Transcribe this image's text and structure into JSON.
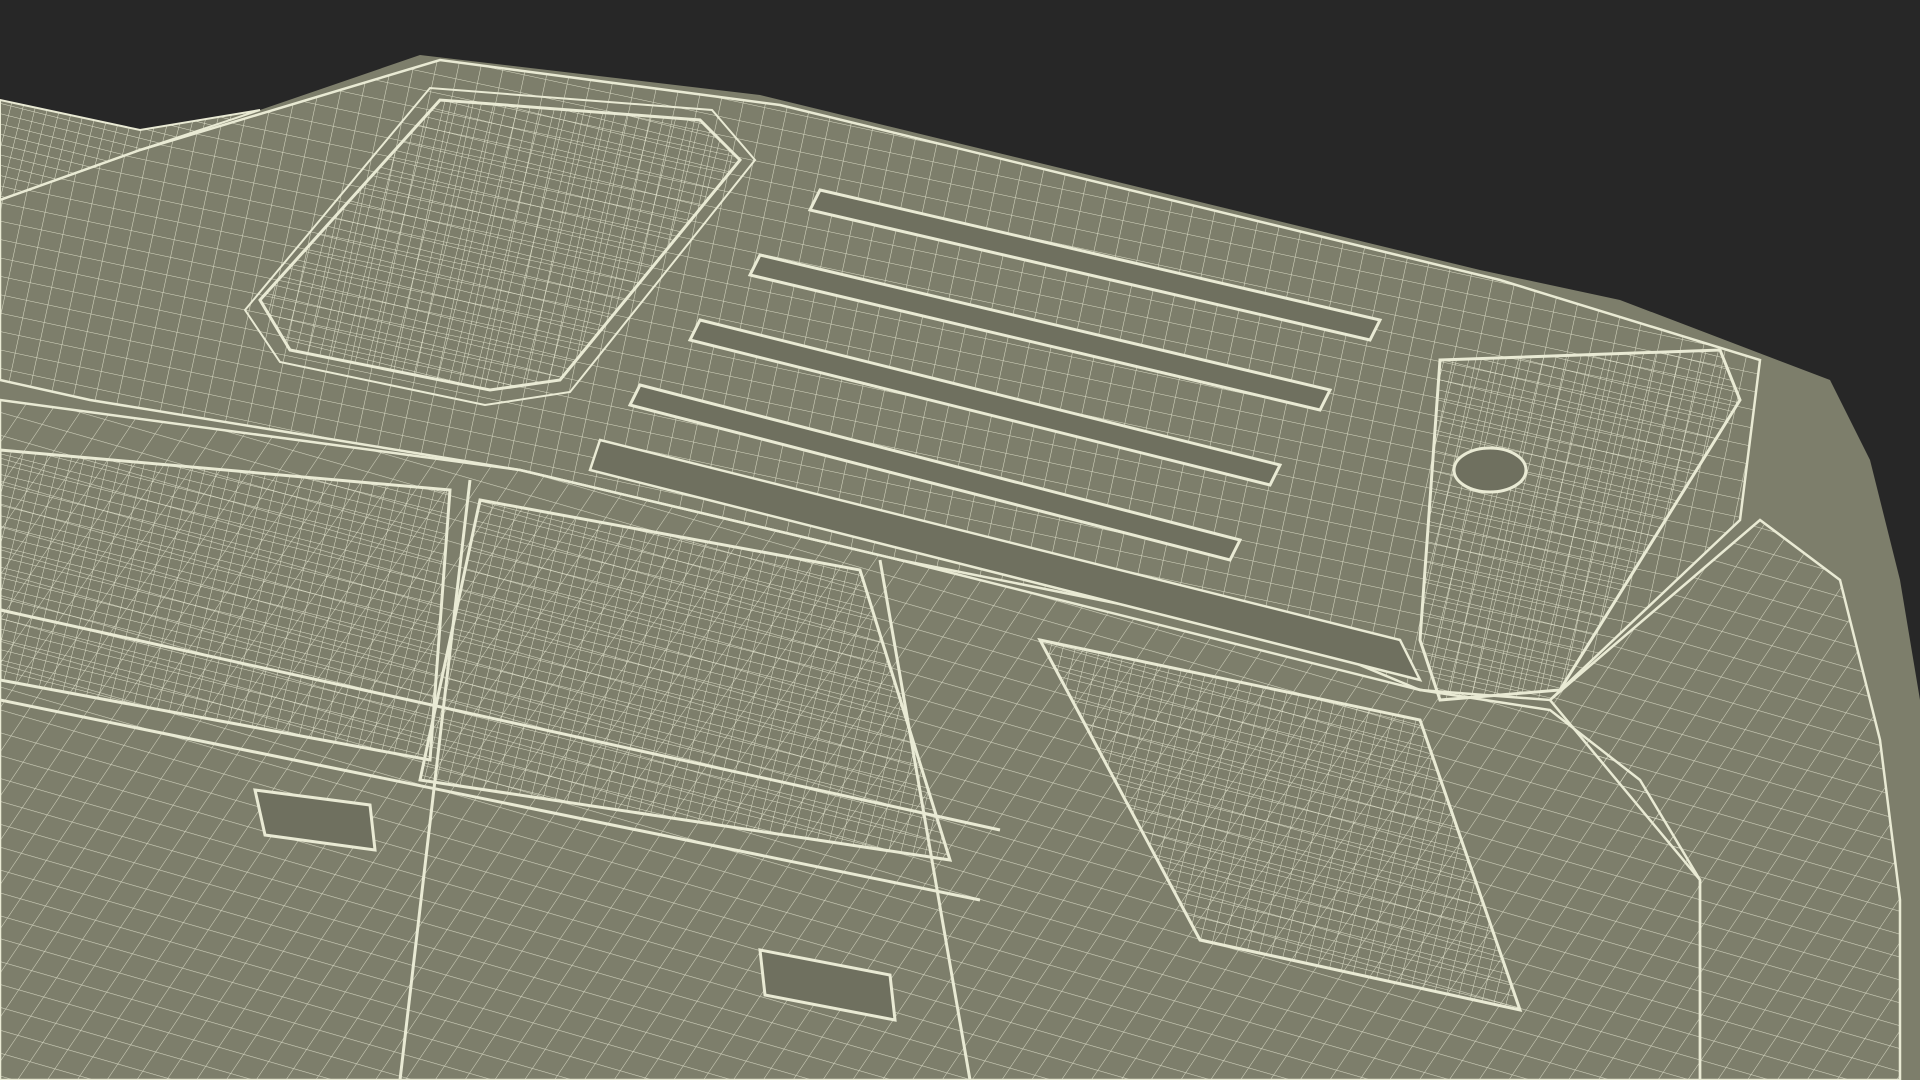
{
  "scene": {
    "subject": "wireframe-suv-render",
    "background_color": "#272727",
    "surface_color": "#7d7e6b",
    "surface_shadow_color": "#6f705f",
    "wire_color": "#e9ead4",
    "icons": [
      "wireframe-mesh-icon"
    ]
  }
}
